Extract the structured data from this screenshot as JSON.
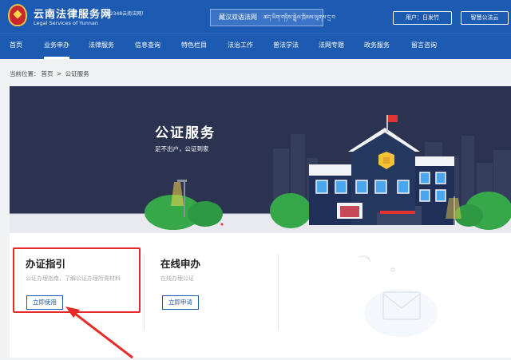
{
  "header": {
    "site_name": "云南法律服务网",
    "site_sub": "（12348云南法网）",
    "site_en": "Legal Services of Yunnan",
    "bilingual_label": "藏汉双语法网",
    "bilingual_script": "ཚད་ཡིག་གཉིས་སྦྲེལ་ཁྲིམས་ལུགས་དྲ་བ",
    "user_button": "用户：日发竹",
    "cloud_button": "智慧公法云"
  },
  "nav": {
    "items": [
      "首页",
      "业务申办",
      "法律服务",
      "信息查询",
      "特色栏目",
      "法治工作",
      "普法学法",
      "法网专题",
      "政务服务",
      "留言咨询"
    ],
    "active_index": 1
  },
  "breadcrumb": {
    "prefix": "当前位置：",
    "home": "首页",
    "separator": ">",
    "current": "公证服务"
  },
  "banner": {
    "title": "公证服务",
    "subtitle": "足不出户，公证到家"
  },
  "cards": [
    {
      "title": "办证指引",
      "desc": "公证办理指南，了解公证办理所需材料",
      "button": "立即使用"
    },
    {
      "title": "在线申办",
      "desc": "在线办理公证",
      "button": "立即申请"
    }
  ],
  "colors": {
    "brand_blue": "#1c5bb1",
    "highlight_red": "#e62a2a",
    "banner_bg": "#2c3351"
  }
}
